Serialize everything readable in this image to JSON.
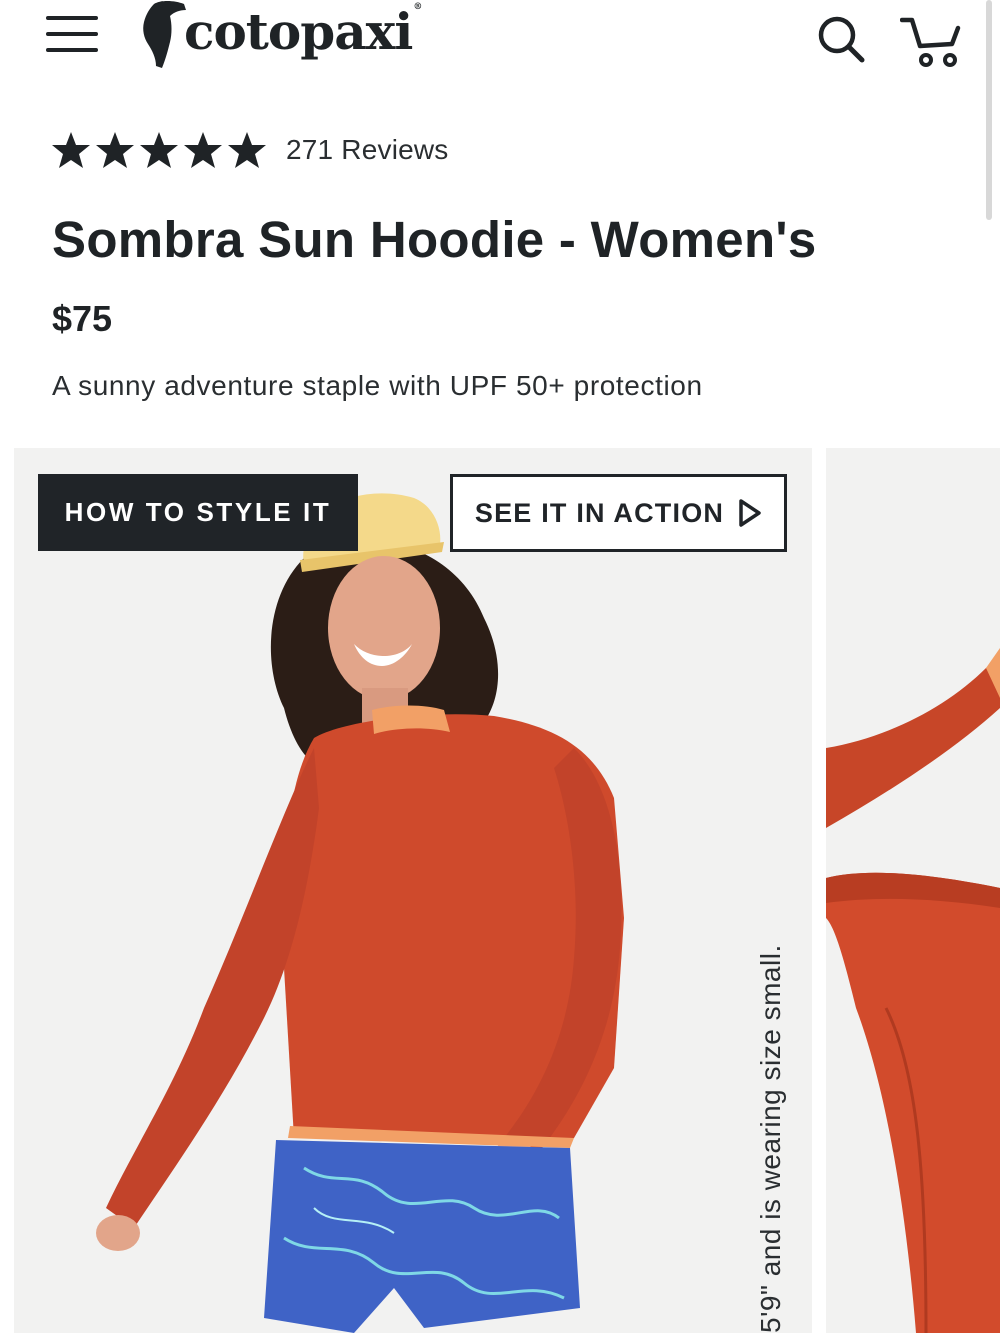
{
  "header": {
    "brand": "cotopaxi",
    "brand_mark": "®",
    "menu_icon": "hamburger-menu-icon",
    "search_icon": "search-icon",
    "cart_icon": "cart-icon"
  },
  "product": {
    "rating_stars": 5,
    "reviews_label": "271 Reviews",
    "title": "Sombra Sun Hoodie - Women's",
    "price": "$75",
    "tagline": "A sunny adventure staple with UPF 50+ protection"
  },
  "gallery": {
    "style_button": "HOW TO STYLE IT",
    "action_button": "SEE IT IN ACTION",
    "action_icon": "play-icon",
    "caption": "5'9\" and is wearing size small."
  },
  "colors": {
    "text": "#1f2326",
    "hoodie": "#cf4a2c",
    "trim": "#f2a066",
    "shorts": "#3f63c6",
    "background": "#f2f2f1"
  }
}
